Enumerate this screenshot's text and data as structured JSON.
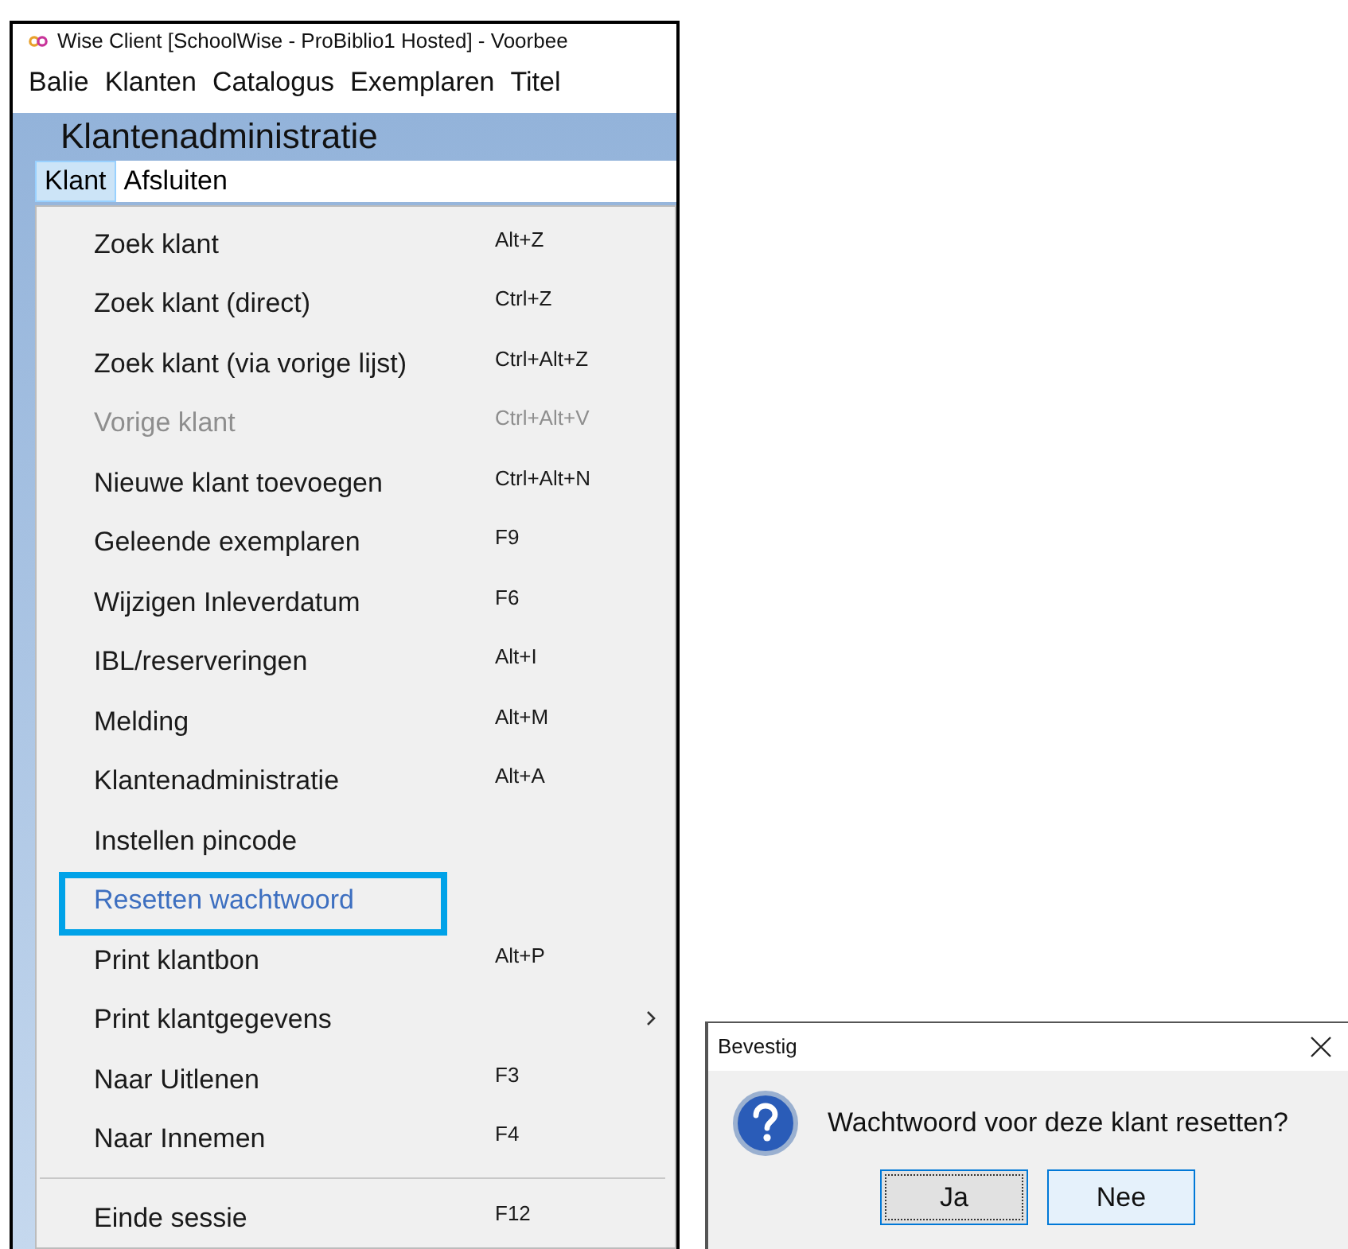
{
  "window": {
    "title": "Wise Client [SchoolWise - ProBiblio1 Hosted] - Voorbee"
  },
  "menu_bar": [
    {
      "label": "Balie"
    },
    {
      "label": "Klanten"
    },
    {
      "label": "Catalogus"
    },
    {
      "label": "Exemplaren"
    },
    {
      "label": "Titel"
    }
  ],
  "module": {
    "title": "Klantenadministratie",
    "menu": [
      {
        "label": "Klant",
        "selected": true
      },
      {
        "label": "Afsluiten",
        "selected": false
      }
    ]
  },
  "dropdown": {
    "items": [
      {
        "kind": "item",
        "label": "Zoek klant",
        "shortcut": "Alt+Z",
        "disabled": false,
        "highlighted": false,
        "submenu": false
      },
      {
        "kind": "item",
        "label": "Zoek klant (direct)",
        "shortcut": "Ctrl+Z",
        "disabled": false,
        "highlighted": false,
        "submenu": false
      },
      {
        "kind": "item",
        "label": "Zoek klant (via vorige lijst)",
        "shortcut": "Ctrl+Alt+Z",
        "disabled": false,
        "highlighted": false,
        "submenu": false
      },
      {
        "kind": "item",
        "label": "Vorige klant",
        "shortcut": "Ctrl+Alt+V",
        "disabled": true,
        "highlighted": false,
        "submenu": false
      },
      {
        "kind": "item",
        "label": "Nieuwe klant toevoegen",
        "shortcut": "Ctrl+Alt+N",
        "disabled": false,
        "highlighted": false,
        "submenu": false
      },
      {
        "kind": "item",
        "label": "Geleende exemplaren",
        "shortcut": "F9",
        "disabled": false,
        "highlighted": false,
        "submenu": false
      },
      {
        "kind": "item",
        "label": "Wijzigen Inleverdatum",
        "shortcut": "F6",
        "disabled": false,
        "highlighted": false,
        "submenu": false
      },
      {
        "kind": "item",
        "label": "IBL/reserveringen",
        "shortcut": "Alt+I",
        "disabled": false,
        "highlighted": false,
        "submenu": false
      },
      {
        "kind": "item",
        "label": "Melding",
        "shortcut": "Alt+M",
        "disabled": false,
        "highlighted": false,
        "submenu": false
      },
      {
        "kind": "item",
        "label": "Klantenadministratie",
        "shortcut": "Alt+A",
        "disabled": false,
        "highlighted": false,
        "submenu": false
      },
      {
        "kind": "item",
        "label": "Instellen pincode",
        "disabled": false,
        "highlighted": false,
        "submenu": false
      },
      {
        "kind": "item",
        "label": "Resetten wachtwoord",
        "disabled": false,
        "highlighted": true,
        "submenu": false
      },
      {
        "kind": "item",
        "label": "Print klantbon",
        "shortcut": "Alt+P",
        "disabled": false,
        "highlighted": false,
        "submenu": false
      },
      {
        "kind": "item",
        "label": "Print klantgegevens",
        "disabled": false,
        "highlighted": false,
        "submenu": true
      },
      {
        "kind": "item",
        "label": "Naar Uitlenen",
        "shortcut": "F3",
        "disabled": false,
        "highlighted": false,
        "submenu": false
      },
      {
        "kind": "item",
        "label": "Naar Innemen",
        "shortcut": "F4",
        "disabled": false,
        "highlighted": false,
        "submenu": false
      },
      {
        "kind": "separator"
      },
      {
        "kind": "item",
        "label": "Einde sessie",
        "shortcut": "F12",
        "disabled": false,
        "highlighted": false,
        "submenu": false
      }
    ]
  },
  "dialog": {
    "title": "Bevestig",
    "message": "Wachtwoord voor deze klant resetten?",
    "buttons": [
      {
        "label": "Ja",
        "focused": true
      },
      {
        "label": "Nee",
        "focused": false
      }
    ]
  }
}
